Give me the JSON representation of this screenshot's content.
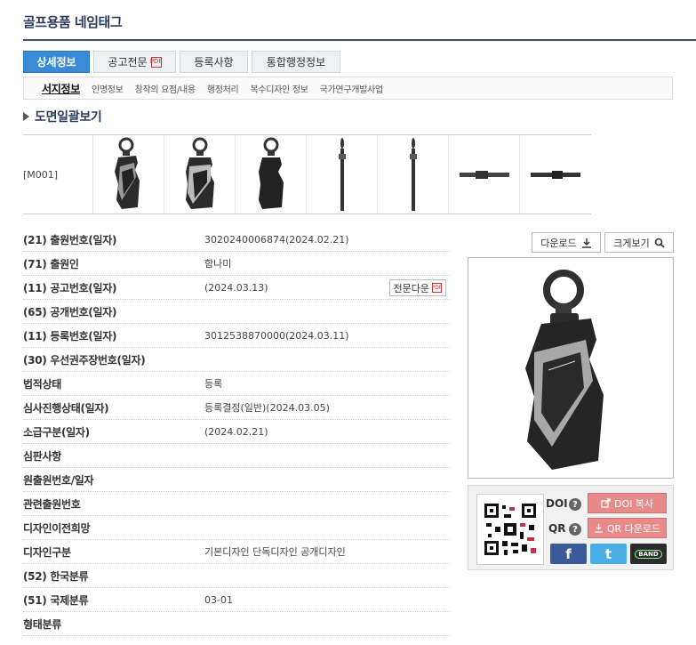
{
  "page_title": "골프용품 네임태그",
  "tabs": [
    {
      "label": "상세정보",
      "active": true
    },
    {
      "label": "공고전문",
      "pdf": true
    },
    {
      "label": "등록사항"
    },
    {
      "label": "통합행정정보"
    }
  ],
  "pdf_mark": "PDF",
  "subtabs": [
    "서지정보",
    "인명정보",
    "창작의 요점/내용",
    "행정처리",
    "복수디자인 정보",
    "국가연구개발사업"
  ],
  "section_title": "도면일괄보기",
  "thumb_label": "[M001]",
  "info_rows": [
    {
      "key": "(21) 출원번호(일자)",
      "value": "3020240006874(2024.02.21)"
    },
    {
      "key": "(71) 출원인",
      "value": "함나미"
    },
    {
      "key": "(11) 공고번호(일자)",
      "value": "(2024.03.13)"
    },
    {
      "key": "(65) 공개번호(일자)",
      "value": ""
    },
    {
      "key": "(11) 등록번호(일자)",
      "value": "3012538870000(2024.03.11)"
    },
    {
      "key": "(30) 우선권주장번호(일자)",
      "value": ""
    },
    {
      "key": "법적상태",
      "value": "등록"
    },
    {
      "key": "심사진행상태(일자)",
      "value": "등록결정(일반)(2024.03.05)"
    },
    {
      "key": "소급구분(일자)",
      "value": "(2024.02.21)"
    },
    {
      "key": "심판사항",
      "value": ""
    },
    {
      "key": "원출원번호/일자",
      "value": ""
    },
    {
      "key": "관련출원번호",
      "value": ""
    },
    {
      "key": "디자인이전희망",
      "value": ""
    },
    {
      "key": "디자인구분",
      "value": "기본디자인 단독디자인 공개디자인"
    },
    {
      "key": "(52) 한국분류",
      "value": ""
    },
    {
      "key": "(51) 국제분류",
      "value": "03-01"
    },
    {
      "key": "형태분류",
      "value": ""
    }
  ],
  "full_text_btn": "전문다운",
  "download_btn": "다운로드",
  "enlarge_btn": "크게보기",
  "doi_label": "DOI",
  "qr_label": "QR",
  "doi_copy_btn": "DOI 복사",
  "qr_download_btn": "QR 다운로드",
  "sns": {
    "facebook": "f",
    "twitter": "t",
    "band": "BAND"
  },
  "colors": {
    "accent": "#3a8bd5",
    "title": "#2a3a5a",
    "pink": "#e88a8a",
    "facebook": "#3b5a9a",
    "twitter": "#49aee3",
    "band": "#2b2b2b"
  }
}
